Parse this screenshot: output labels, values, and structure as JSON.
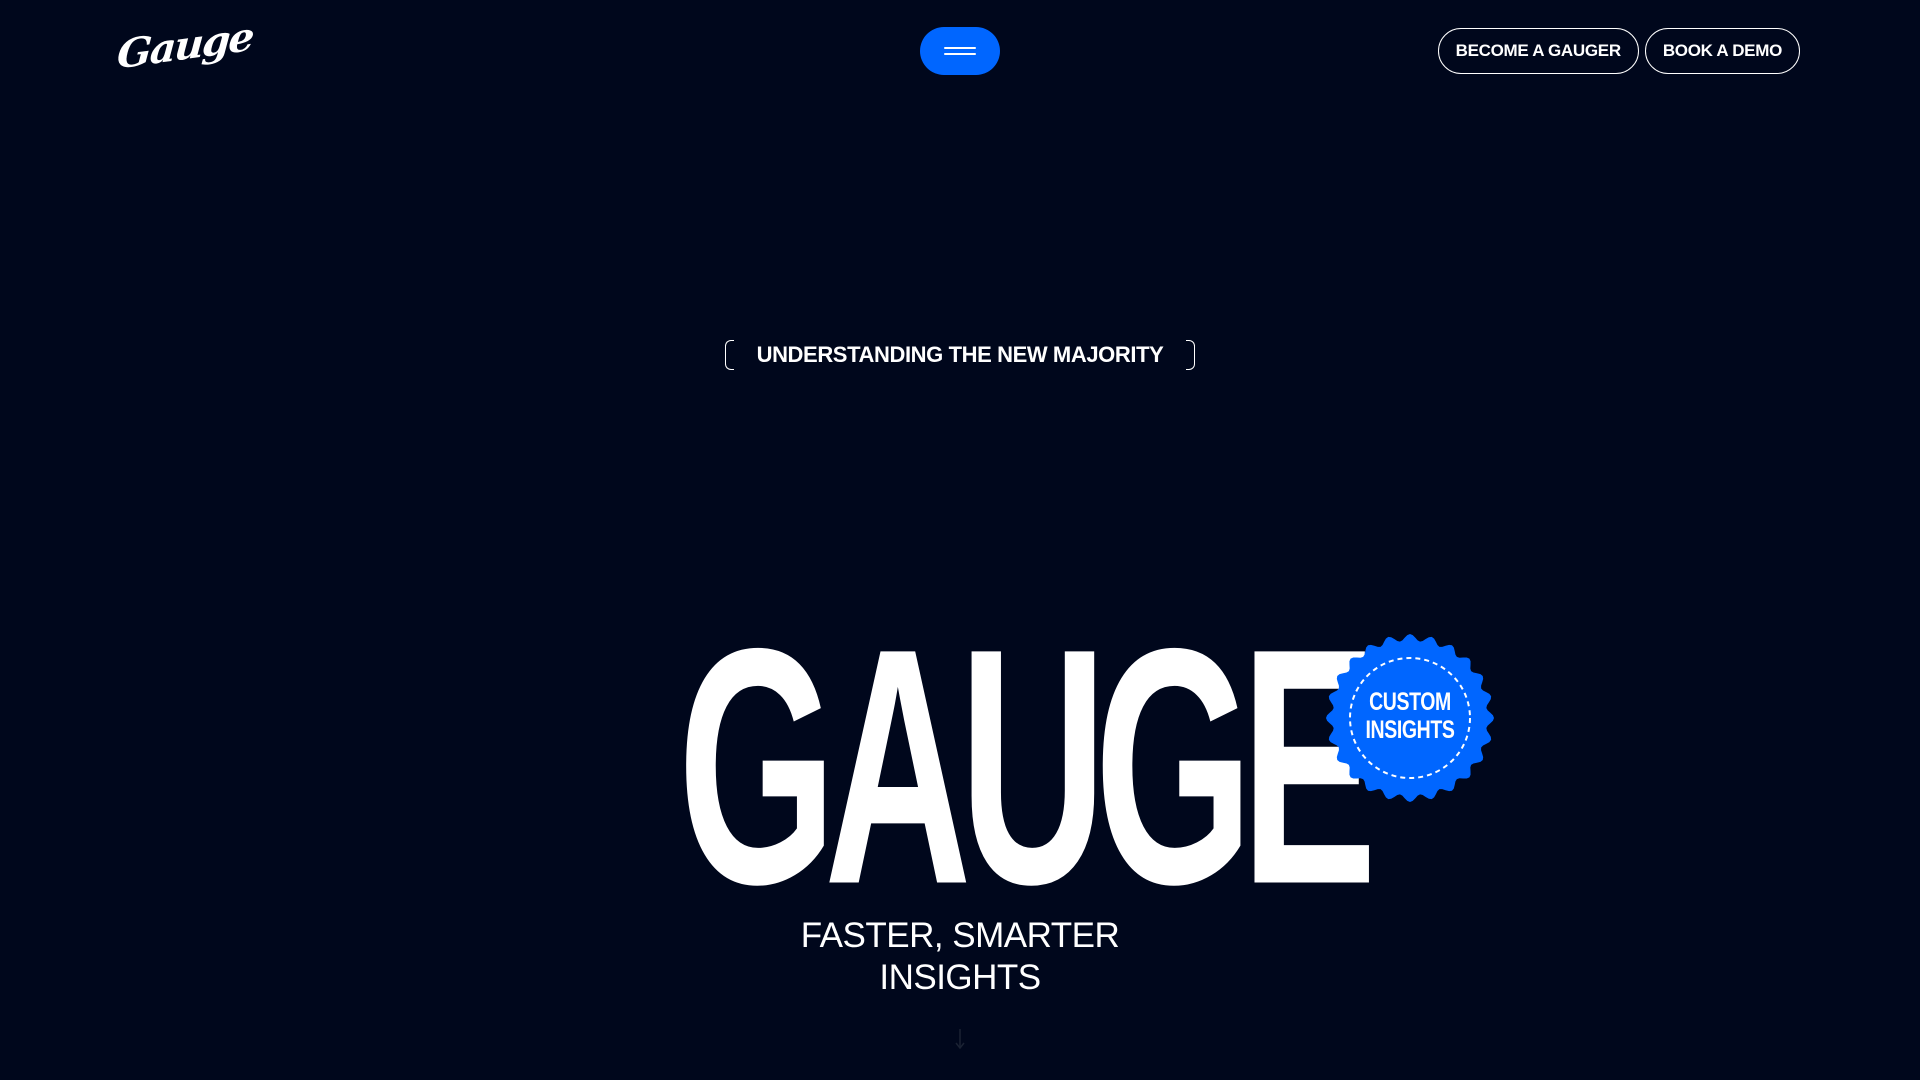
{
  "header": {
    "logo_text": "Gauge",
    "menu_button_label": "Menu",
    "become_gauger_label": "BECOME A GAUGER",
    "book_demo_label": "BOOK A DEMO"
  },
  "hero": {
    "eyebrow": "UNDERSTANDING THE NEW MAJORITY",
    "title": "GAUGE",
    "badge": {
      "line1": "CUSTOM",
      "line2": "INSIGHTS"
    },
    "tagline_line1": "FASTER, SMARTER",
    "tagline_line2": "INSIGHTS"
  },
  "icons": {
    "menu": "hamburger-icon",
    "scroll": "arrow-down-icon"
  },
  "colors": {
    "background": "#00071c",
    "accent": "#0066ff",
    "text": "#ffffff"
  }
}
